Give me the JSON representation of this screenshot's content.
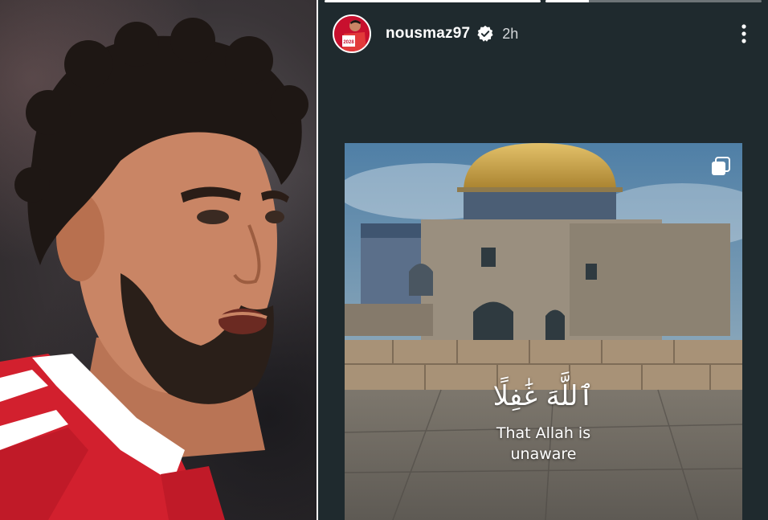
{
  "left_photo": {
    "subject": "footballer-portrait"
  },
  "story": {
    "progress": [
      1.0,
      0.2
    ],
    "header": {
      "username": "nousmaz97",
      "verified_icon": "verified-badge-icon",
      "time": "2h",
      "more_icon": "more-vertical-icon"
    },
    "avatar": {
      "jersey_number": "2028"
    },
    "post": {
      "carousel_icon": "carousel-icon",
      "arabic_text": "ٱللَّهَ غَٰفِلًا",
      "english_text": "That Allah is\nunaware"
    }
  },
  "colors": {
    "story_bg": "#1f2a2e",
    "jersey_red": "#c8102e",
    "dome_gold": "#c9a043",
    "stone": "#9a8f7f"
  }
}
